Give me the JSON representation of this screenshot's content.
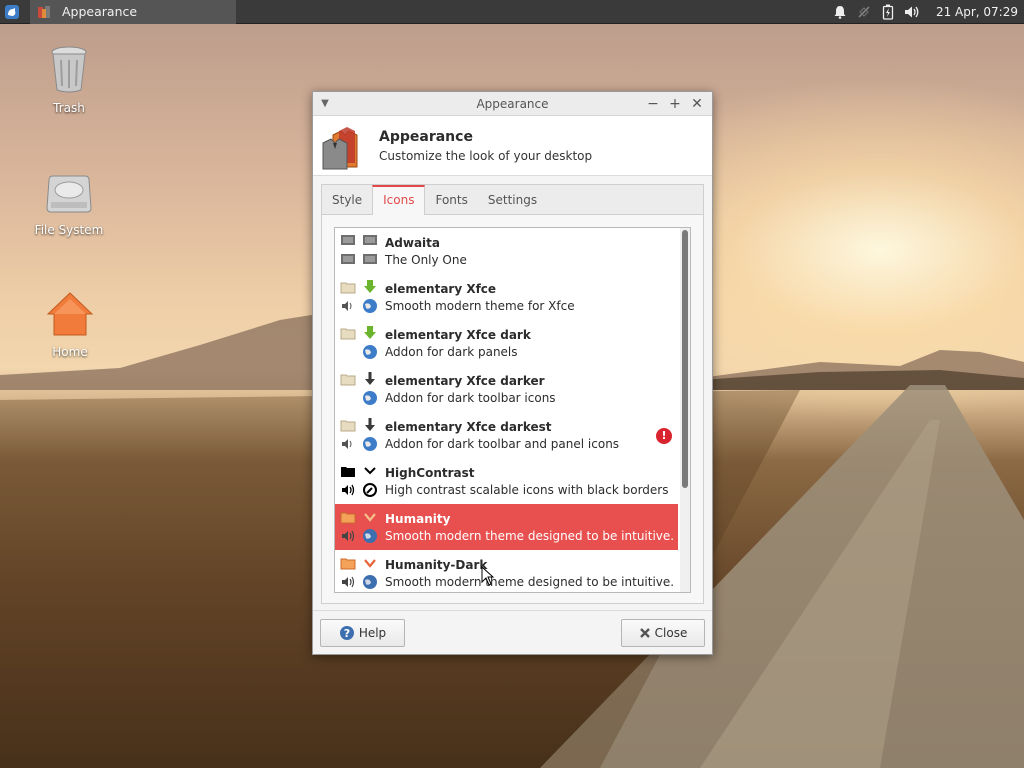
{
  "panel": {
    "task_title": "Appearance",
    "clock": "21 Apr, 07:29"
  },
  "desktop": {
    "icons": [
      {
        "label": "Trash"
      },
      {
        "label": "File System"
      },
      {
        "label": "Home"
      }
    ]
  },
  "window": {
    "title": "Appearance",
    "header_title": "Appearance",
    "header_subtitle": "Customize the look of your desktop",
    "tabs": [
      {
        "label": "Style",
        "active": false
      },
      {
        "label": "Icons",
        "active": true
      },
      {
        "label": "Fonts",
        "active": false
      },
      {
        "label": "Settings",
        "active": false
      }
    ],
    "themes": [
      {
        "name": "Adwaita",
        "description": "The Only One"
      },
      {
        "name": "elementary Xfce",
        "description": "Smooth modern theme for Xfce"
      },
      {
        "name": "elementary Xfce dark",
        "description": "Addon for dark panels"
      },
      {
        "name": "elementary Xfce darker",
        "description": "Addon for dark toolbar icons"
      },
      {
        "name": "elementary Xfce darkest",
        "description": "Addon for dark toolbar and panel icons",
        "warning": "!"
      },
      {
        "name": "HighContrast",
        "description": "High contrast scalable icons with black borders"
      },
      {
        "name": "Humanity",
        "description": "Smooth modern theme designed to be intuitive.",
        "selected": true
      },
      {
        "name": "Humanity-Dark",
        "description": "Smooth modern theme designed to be intuitive."
      }
    ],
    "help_label": "Help",
    "close_label": "Close"
  },
  "colors": {
    "accent": "#e84f4f",
    "panel": "#3a3a3a"
  }
}
